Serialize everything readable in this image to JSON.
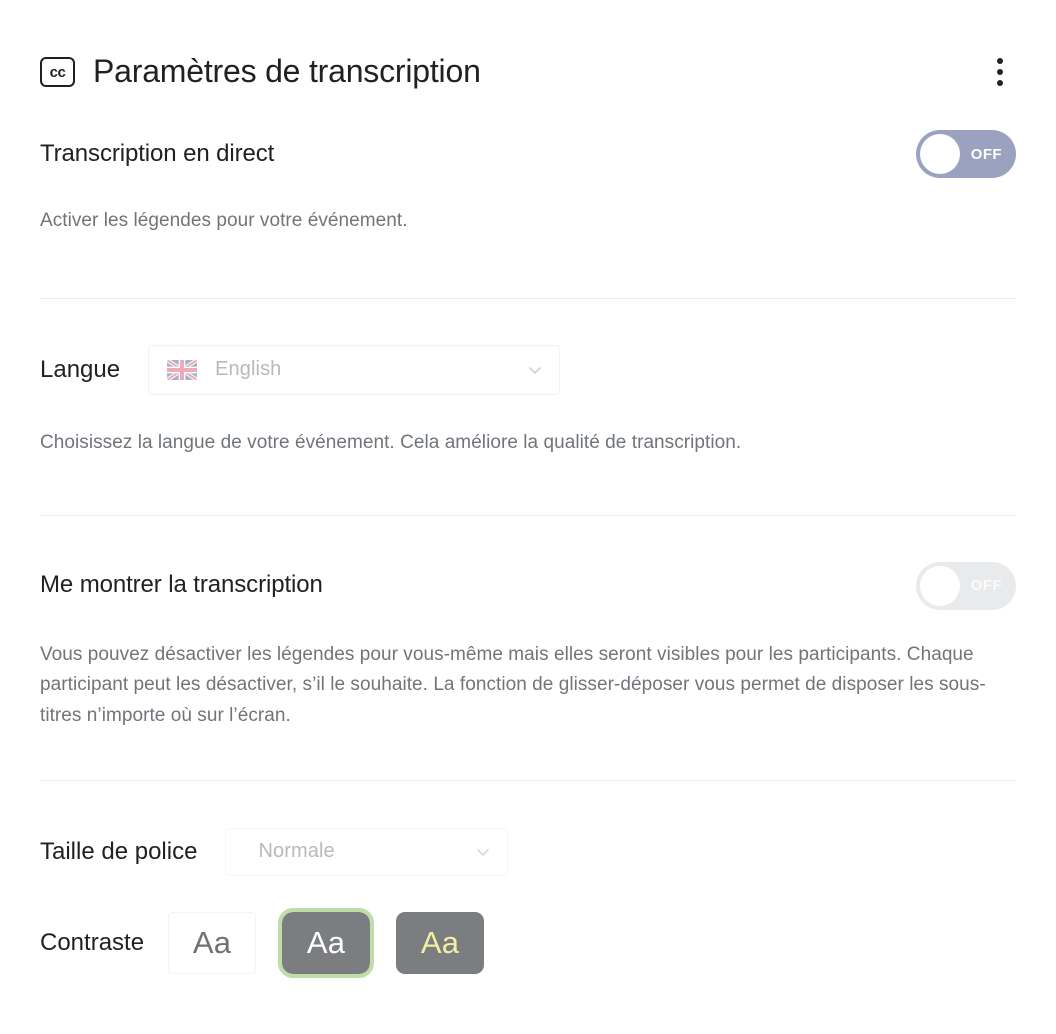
{
  "header": {
    "icon_label": "cc",
    "title": "Paramètres de transcription",
    "menu_label": "⋮"
  },
  "sections": {
    "live_transcription": {
      "title": "Transcription en direct",
      "description": "Activer les légendes pour votre événement.",
      "toggle_state": "OFF"
    },
    "language": {
      "label": "Langue",
      "selected": "English",
      "flag": "uk-flag-icon",
      "description": "Choisissez la langue de votre événement. Cela améliore la qualité de transcription."
    },
    "show_transcription": {
      "title": "Me montrer la transcription",
      "description": "Vous pouvez désactiver les légendes pour vous-même mais elles seront visibles pour les participants. Chaque participant peut les désactiver, s’il le souhaite. La fonction de glisser-déposer vous permet de disposer les sous-titres n’importe où sur l’écran.",
      "toggle_state": "OFF"
    },
    "font_size": {
      "label": "Taille de police",
      "selected": "Normale"
    },
    "contrast": {
      "label": "Contraste",
      "options": [
        {
          "sample": "Aa",
          "style": "light",
          "selected": false
        },
        {
          "sample": "Aa",
          "style": "dark",
          "selected": true
        },
        {
          "sample": "Aa",
          "style": "yellow",
          "selected": false
        }
      ]
    }
  },
  "colors": {
    "toggle_on_track": "#9ba2c0",
    "toggle_off_track": "#e9eaec",
    "selection_ring": "#c0dca8",
    "swatch_dark_bg": "#7b7d80",
    "swatch_yellow_text": "#f4efa0",
    "text_primary": "#202124",
    "text_secondary": "#70757a",
    "divider": "#eceded"
  }
}
